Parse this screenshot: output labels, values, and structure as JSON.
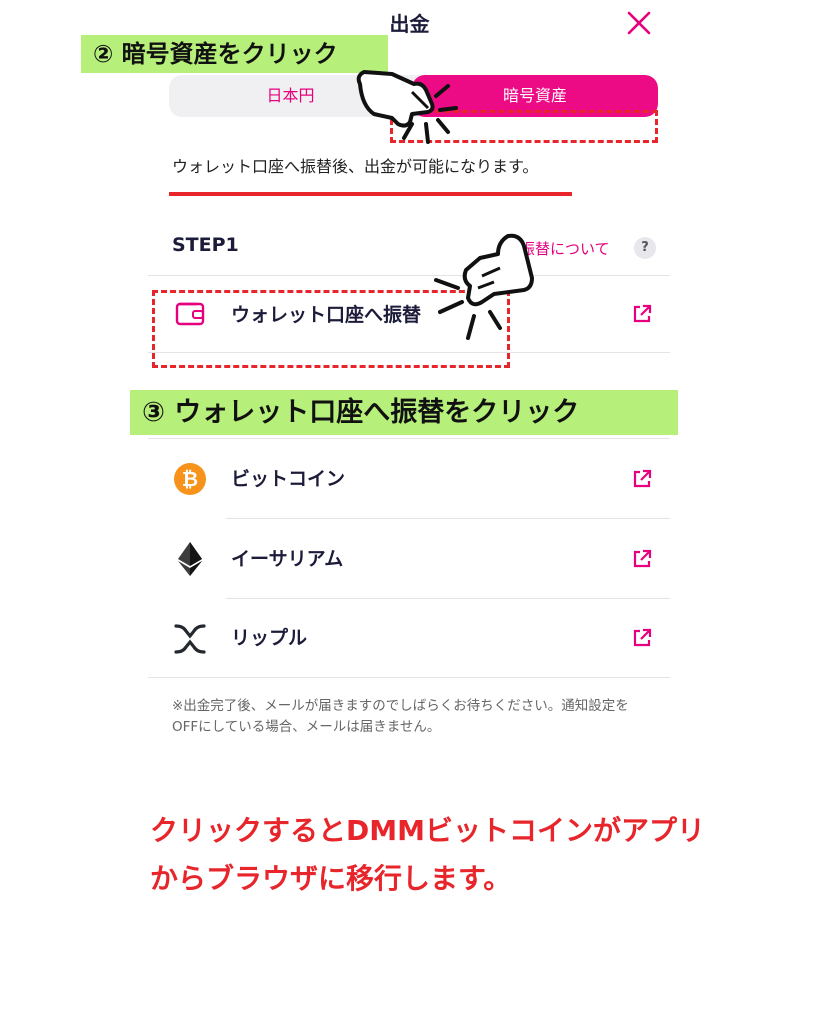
{
  "header": {
    "title": "出金"
  },
  "annotations": {
    "step2": "② 暗号資産をクリック",
    "step3": "③ ウォレット口座へ振替をクリック"
  },
  "tabs": [
    {
      "label": "日本円",
      "active": false
    },
    {
      "label": "暗号資産",
      "active": true
    }
  ],
  "info_text": "ウォレット口座へ振替後、出金が可能になります。",
  "step": {
    "label": "STEP1",
    "about_link": "振替について",
    "help_icon_text": "?"
  },
  "wallet_transfer": {
    "label": "ウォレット口座へ振替",
    "icon": "wallet-icon"
  },
  "assets": [
    {
      "label": "ビットコイン",
      "icon": "bitcoin-icon"
    },
    {
      "label": "イーサリアム",
      "icon": "ethereum-icon"
    },
    {
      "label": "リップル",
      "icon": "ripple-icon"
    }
  ],
  "note": "※出金完了後、メールが届きますのでしばらくお待ちください。通知設定をOFFにしている場合、メールは届きません。",
  "bottom_message": "クリックするとDMMビットコインがアプリからブラウザに移行します。",
  "colors": {
    "accent": "#ed0a85",
    "annotation_bg": "#b6ef7a",
    "highlight_red": "#e8252b",
    "bitcoin": "#f7931a"
  }
}
